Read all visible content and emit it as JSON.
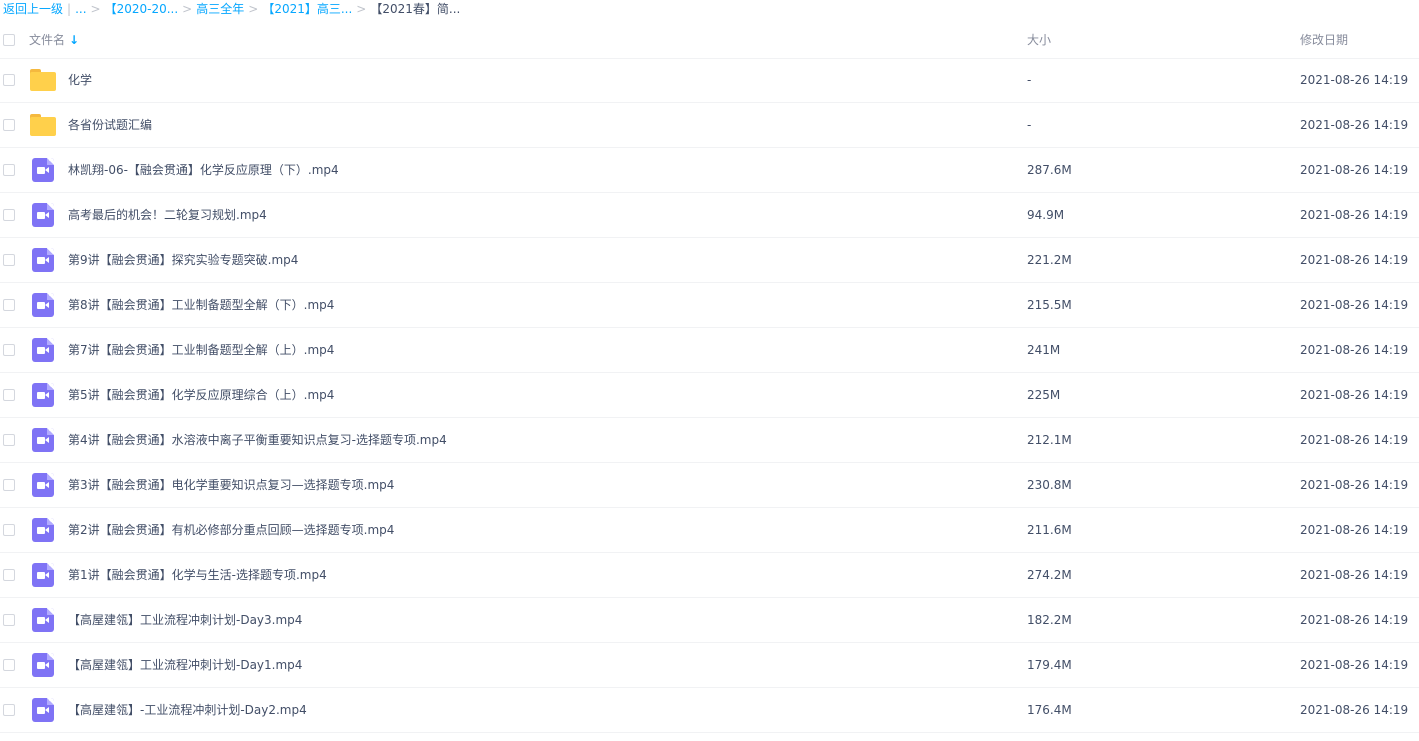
{
  "breadcrumb": {
    "back": "返回上一级",
    "ellipsis": "...",
    "items": [
      "【2020-20...",
      "高三全年",
      "【2021】高三..."
    ],
    "current": "【2021春】简..."
  },
  "header": {
    "name": "文件名",
    "sort_icon": "sort-arrow-down-icon",
    "size": "大小",
    "date": "修改日期"
  },
  "colors": {
    "accent": "#06a7ff",
    "folder": "#ffd04b",
    "video": "#7f73f5"
  },
  "files": [
    {
      "type": "folder",
      "name": "化学",
      "size": "-",
      "date": "2021-08-26 14:19"
    },
    {
      "type": "folder",
      "name": "各省份试题汇编",
      "size": "-",
      "date": "2021-08-26 14:19"
    },
    {
      "type": "video",
      "name": "林凯翔-06-【融会贯通】化学反应原理（下）.mp4",
      "size": "287.6M",
      "date": "2021-08-26 14:19"
    },
    {
      "type": "video",
      "name": "高考最后的机会！二轮复习规划.mp4",
      "size": "94.9M",
      "date": "2021-08-26 14:19"
    },
    {
      "type": "video",
      "name": "第9讲【融会贯通】探究实验专题突破.mp4",
      "size": "221.2M",
      "date": "2021-08-26 14:19"
    },
    {
      "type": "video",
      "name": "第8讲【融会贯通】工业制备题型全解（下）.mp4",
      "size": "215.5M",
      "date": "2021-08-26 14:19"
    },
    {
      "type": "video",
      "name": "第7讲【融会贯通】工业制备题型全解（上）.mp4",
      "size": "241M",
      "date": "2021-08-26 14:19"
    },
    {
      "type": "video",
      "name": "第5讲【融会贯通】化学反应原理综合（上）.mp4",
      "size": "225M",
      "date": "2021-08-26 14:19"
    },
    {
      "type": "video",
      "name": "第4讲【融会贯通】水溶液中离子平衡重要知识点复习-选择题专项.mp4",
      "size": "212.1M",
      "date": "2021-08-26 14:19"
    },
    {
      "type": "video",
      "name": "第3讲【融会贯通】电化学重要知识点复习—选择题专项.mp4",
      "size": "230.8M",
      "date": "2021-08-26 14:19"
    },
    {
      "type": "video",
      "name": "第2讲【融会贯通】有机必修部分重点回顾—选择题专项.mp4",
      "size": "211.6M",
      "date": "2021-08-26 14:19"
    },
    {
      "type": "video",
      "name": "第1讲【融会贯通】化学与生活-选择题专项.mp4",
      "size": "274.2M",
      "date": "2021-08-26 14:19"
    },
    {
      "type": "video",
      "name": "【高屋建瓴】工业流程冲刺计划-Day3.mp4",
      "size": "182.2M",
      "date": "2021-08-26 14:19"
    },
    {
      "type": "video",
      "name": "【高屋建瓴】工业流程冲刺计划-Day1.mp4",
      "size": "179.4M",
      "date": "2021-08-26 14:19"
    },
    {
      "type": "video",
      "name": "【高屋建瓴】-工业流程冲刺计划-Day2.mp4",
      "size": "176.4M",
      "date": "2021-08-26 14:19"
    }
  ]
}
